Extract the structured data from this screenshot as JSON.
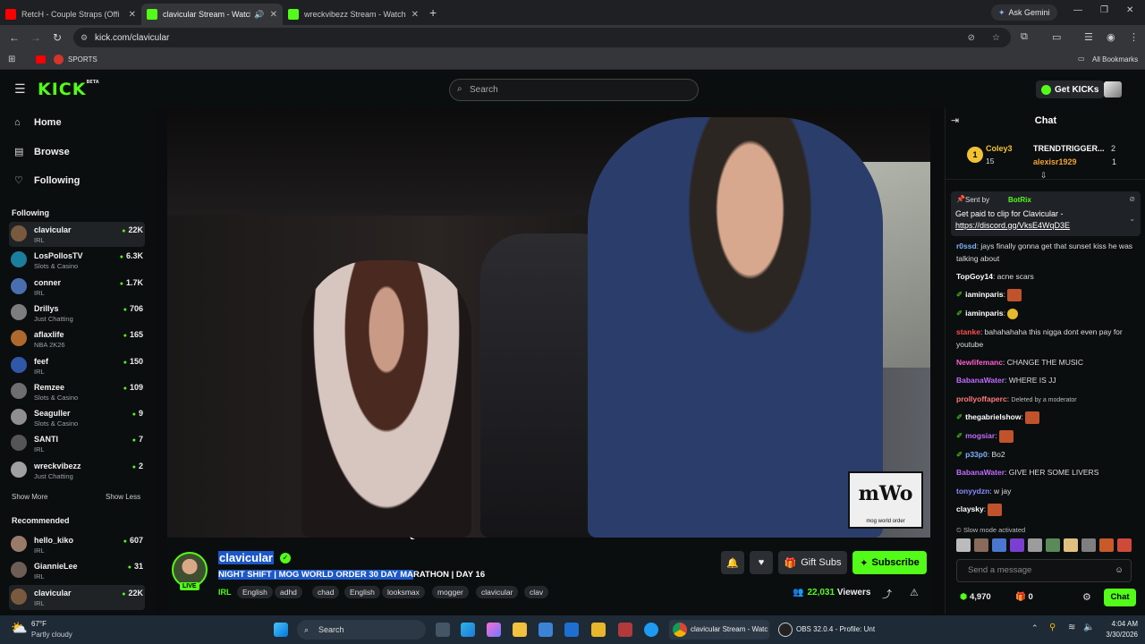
{
  "browser": {
    "tabs": [
      {
        "title": "RetcH - Couple Straps (Offi",
        "color": "#ff0000"
      },
      {
        "title": "clavicular Stream - Watch Li",
        "color": "#53fc18"
      },
      {
        "title": "wreckvibezz Stream - Watch Li",
        "color": "#53fc18"
      }
    ],
    "ask_gemini": "Ask Gemini",
    "url": "kick.com/clavicular",
    "bookmark_sports": "SPORTS",
    "all_bookmarks": "All Bookmarks"
  },
  "header": {
    "logo": "KICK",
    "logo_badge": "BETA",
    "search_placeholder": "Search",
    "get_kicks": "Get KICKs"
  },
  "sidebar": {
    "nav": [
      {
        "label": "Home",
        "icon": "⌂"
      },
      {
        "label": "Browse",
        "icon": "▤"
      },
      {
        "label": "Following",
        "icon": "♡"
      }
    ],
    "following_title": "Following",
    "following": [
      {
        "name": "clavicular",
        "category": "IRL",
        "viewers": "22K",
        "color": "#7a5a3f"
      },
      {
        "name": "LosPollosTV",
        "category": "Slots & Casino",
        "viewers": "6.3K",
        "color": "#1b7e9e"
      },
      {
        "name": "conner",
        "category": "IRL",
        "viewers": "1.7K",
        "color": "#4a6fb0"
      },
      {
        "name": "Drillys",
        "category": "Just Chatting",
        "viewers": "706",
        "color": "#7d7d7d"
      },
      {
        "name": "aflaxlife",
        "category": "NBA 2K26",
        "viewers": "165",
        "color": "#b0692c"
      },
      {
        "name": "feef",
        "category": "IRL",
        "viewers": "150",
        "color": "#3157a8"
      },
      {
        "name": "Remzee",
        "category": "Slots & Casino",
        "viewers": "109",
        "color": "#6e6e6e"
      },
      {
        "name": "Seaguller",
        "category": "Slots & Casino",
        "viewers": "9",
        "color": "#8f8f8f"
      },
      {
        "name": "SANTI",
        "category": "IRL",
        "viewers": "7",
        "color": "#555555"
      },
      {
        "name": "wreckvibezz",
        "category": "Just Chatting",
        "viewers": "2",
        "color": "#a0a0a0"
      }
    ],
    "show_more": "Show More",
    "show_less": "Show Less",
    "recommended_title": "Recommended",
    "recommended": [
      {
        "name": "hello_kiko",
        "category": "IRL",
        "viewers": "607",
        "color": "#9a7b6a"
      },
      {
        "name": "GiannieLee",
        "category": "IRL",
        "viewers": "31",
        "color": "#6d5d55"
      },
      {
        "name": "clavicular",
        "category": "IRL",
        "viewers": "22K",
        "color": "#7a5a3f"
      }
    ]
  },
  "video": {
    "watermark": "mWo",
    "watermark_sub": "mog world order"
  },
  "stream": {
    "streamer": "clavicular",
    "live": "LIVE",
    "title_highlight": "NIGHT SHIFT | MOG WORLD ORDER 30 DAY MA",
    "title_rest": "RATHON | DAY 16",
    "category": "IRL",
    "tags": [
      "English",
      "adhd",
      "chad",
      "English",
      "looksmax",
      "mogger",
      "clavicular",
      "clav"
    ],
    "gift_subs": "Gift Subs",
    "subscribe": "Subscribe",
    "viewers": "22,031",
    "viewers_label": "Viewers"
  },
  "chat": {
    "title": "Chat",
    "leaderboard": [
      {
        "rank": "1",
        "name": "Coley3",
        "count": "15"
      },
      {
        "name": "TRENDTRIGGER...",
        "count": "2"
      },
      {
        "name": "alexisr1929",
        "count": "1"
      }
    ],
    "pinned": {
      "sent_by": "Sent by",
      "bot": "BotRix",
      "text": "Get paid to clip for Clavicular -",
      "link": "https://discord.gg/VksE4WqD3E"
    },
    "messages": [
      {
        "user": "r0ssd",
        "text": "jays finally gonna get that sunset kiss he was talking about",
        "color": "#7fb3ff"
      },
      {
        "user": "TopGoy14",
        "text": "acne scars",
        "color": "#ffffff"
      },
      {
        "user": "iaminparis",
        "text": "",
        "color": "#ffffff"
      },
      {
        "user": "iaminparis",
        "text": "",
        "color": "#ffffff"
      },
      {
        "user": "stanke",
        "text": "bahahahaha this nigga dont even pay for youtube",
        "color": "#ff4d4d"
      },
      {
        "user": "Newlifemanc",
        "text": "CHANGE THE MUSIC",
        "color": "#ff5fd2"
      },
      {
        "user": "BabanaWater",
        "text": "WHERE IS JJ",
        "color": "#c06cff"
      },
      {
        "user": "prollyoffaperc",
        "text": "Deleted by a moderator",
        "color": "#ff7b7b"
      },
      {
        "user": "thegabrielshow",
        "text": "",
        "color": "#ffffff"
      },
      {
        "user": "mogsiar",
        "text": "",
        "color": "#c06cff"
      },
      {
        "user": "p33p0",
        "text": "Bo2",
        "color": "#7fb3ff"
      },
      {
        "user": "BabanaWater",
        "text": "GIVE HER SOME LIVERS",
        "color": "#c06cff"
      },
      {
        "user": "tonyydzn",
        "text": "w jay",
        "color": "#8a8aff"
      },
      {
        "user": "claysky",
        "text": "",
        "color": "#ffffff"
      }
    ],
    "slow_mode": "Slow mode activated",
    "input_placeholder": "Send a message",
    "points": "4,970",
    "gift_count": "0",
    "send": "Chat"
  },
  "taskbar": {
    "weather_temp": "67°F",
    "weather_desc": "Partly cloudy",
    "search": "Search",
    "app1": "clavicular Stream - Watc",
    "app2": "OBS 32.0.4 - Profile: Unt",
    "time": "4:04 AM",
    "date": "3/30/2026"
  }
}
